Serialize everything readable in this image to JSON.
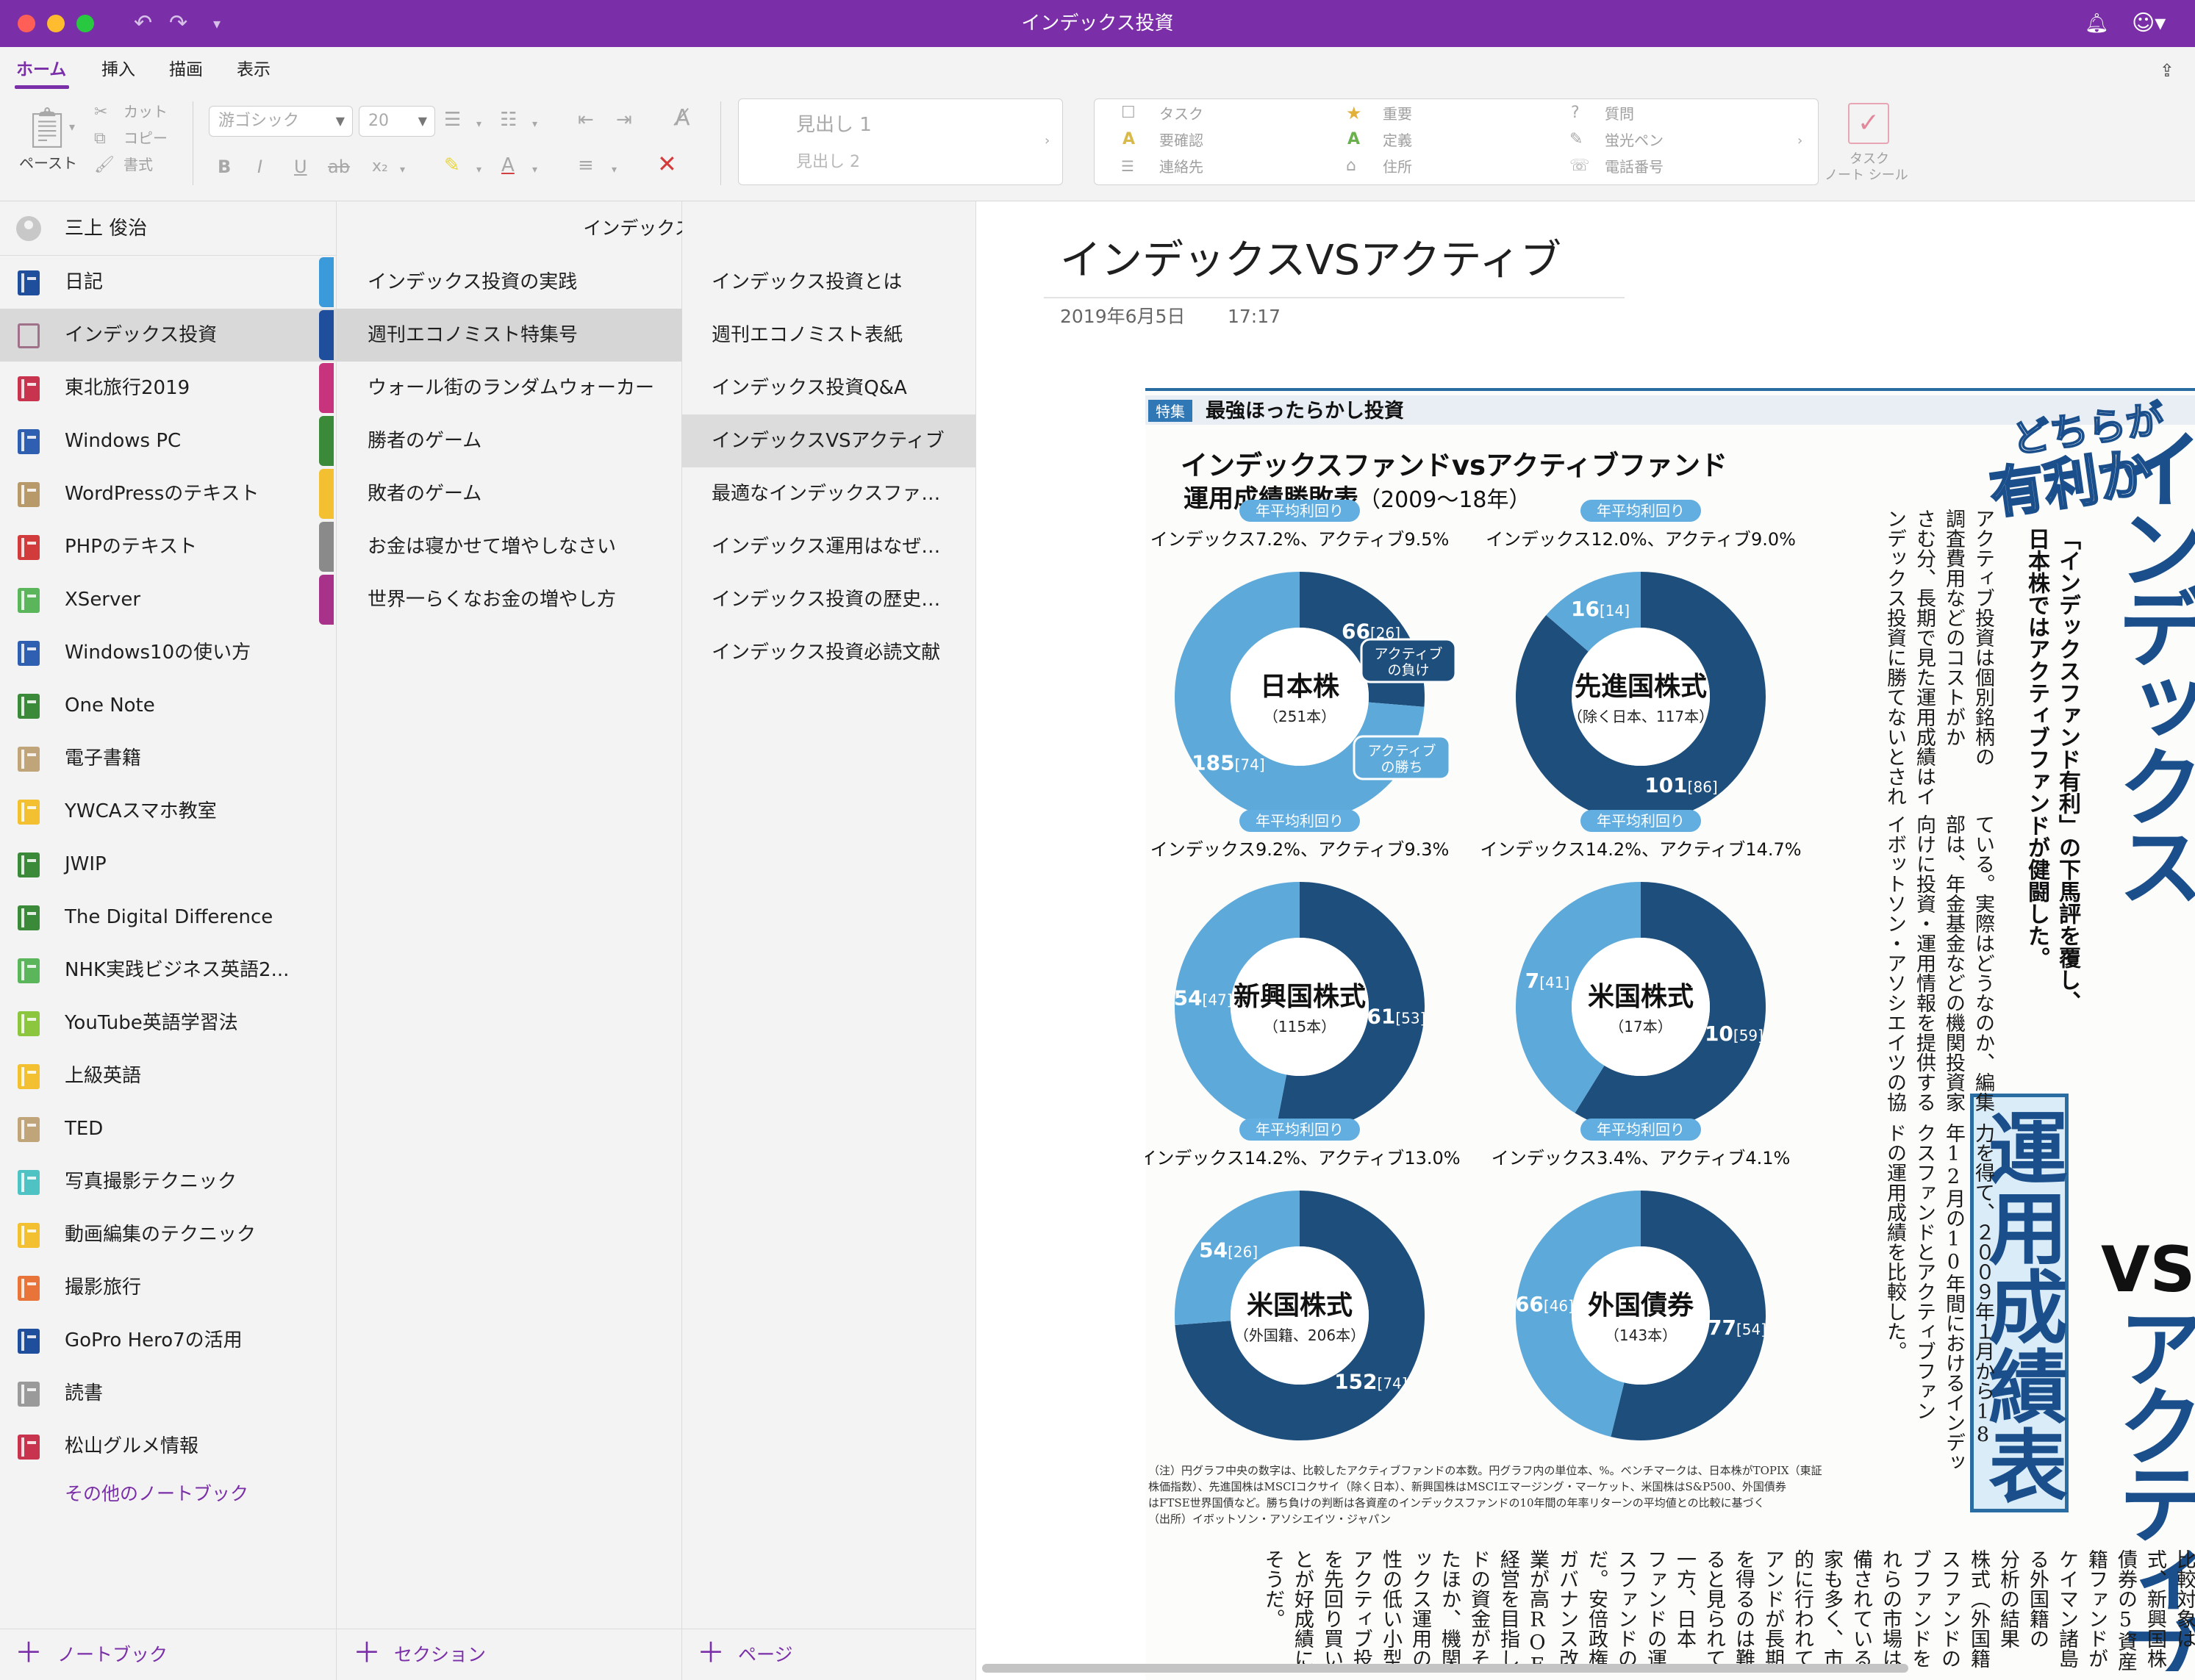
{
  "window": {
    "title": "インデックス投資"
  },
  "ribbon": {
    "tabs": [
      "ホーム",
      "挿入",
      "描画",
      "表示"
    ],
    "clipboard": {
      "paste": "ペースト",
      "cut": "カット",
      "copy": "コピー",
      "format": "書式"
    },
    "font": {
      "family": "游ゴシック",
      "size": "20"
    },
    "styles": {
      "heading1": "見出し 1",
      "heading2": "見出し 2"
    },
    "tags": {
      "col1": [
        "タスク",
        "要確認",
        "連絡先"
      ],
      "col2": [
        "重要",
        "定義",
        "住所"
      ],
      "col3": [
        "質問",
        "蛍光ペン",
        "電話番号"
      ]
    },
    "task_tag": {
      "line1": "タスク",
      "line2": "ノート シール"
    }
  },
  "user": {
    "name": "三上 俊治"
  },
  "notebooks": [
    {
      "label": "日記",
      "color": "#1f4e9c"
    },
    {
      "label": "インデックス投資",
      "color": "#a0728a"
    },
    {
      "label": "東北旅行2019",
      "color": "#c8334e"
    },
    {
      "label": "Windows PC",
      "color": "#2e5fb0"
    },
    {
      "label": "WordPressのテキスト",
      "color": "#b89a6a"
    },
    {
      "label": "PHPのテキスト",
      "color": "#d23b3b"
    },
    {
      "label": "XServer",
      "color": "#5bb55b"
    },
    {
      "label": "Windows10の使い方",
      "color": "#2e5fb0"
    },
    {
      "label": "One Note",
      "color": "#3a8a3a"
    },
    {
      "label": "電子書籍",
      "color": "#c0a57a"
    },
    {
      "label": "YWCAスマホ教室",
      "color": "#f2c030"
    },
    {
      "label": "JWIP",
      "color": "#3a8a3a"
    },
    {
      "label": "The Digital Difference",
      "color": "#3a8a3a"
    },
    {
      "label": "NHK実践ビジネス英語2...",
      "color": "#5bb55b"
    },
    {
      "label": "YouTube英語学習法",
      "color": "#8cc63e"
    },
    {
      "label": "上級英語",
      "color": "#f2c030"
    },
    {
      "label": "TED",
      "color": "#c0a57a"
    },
    {
      "label": "写真撮影テクニック",
      "color": "#4fc3c3"
    },
    {
      "label": "動画編集のテクニック",
      "color": "#f2c030"
    },
    {
      "label": "撮影旅行",
      "color": "#e8743a"
    },
    {
      "label": "GoPro Hero7の活用",
      "color": "#1f4e9c"
    },
    {
      "label": "読書",
      "color": "#9a9a9a"
    },
    {
      "label": "松山グルメ情報",
      "color": "#c8334e"
    }
  ],
  "more_notebooks": "その他のノートブック",
  "add_notebook": "ノートブック",
  "sections_header": "インデックス投資",
  "sections": [
    {
      "label": "インデックス投資の実践",
      "color": "#3b9ad9"
    },
    {
      "label": "週刊エコノミスト特集号",
      "color": "#1f4e9c"
    },
    {
      "label": "ウォール街のランダムウォーカー",
      "color": "#c8337e"
    },
    {
      "label": "勝者のゲーム",
      "color": "#3a8a3a"
    },
    {
      "label": "敗者のゲーム",
      "color": "#f2c030"
    },
    {
      "label": "お金は寝かせて増やしなさい",
      "color": "#8a8a8a"
    },
    {
      "label": "世界一らくなお金の増やし方",
      "color": "#a8328a"
    }
  ],
  "add_section": "セクション",
  "pages": [
    "インデックス投資とは",
    "週刊エコノミスト表紙",
    "インデックス投資Q&A",
    "インデックスVSアクティブ",
    "最適なインデックスファ…",
    "インデックス運用はなぜ…",
    "インデックス投資の歴史…",
    "インデックス投資必読文献"
  ],
  "add_page": "ページ",
  "note": {
    "title": "インデックスVSアクティブ",
    "date": "2019年6月5日",
    "time": "17:17"
  },
  "magazine": {
    "tag": "特集",
    "header": "最強ほったらかし投資",
    "chart_title": "インデックスファンドvsアクティブファンド",
    "chart_subtitle_main": "運用成績勝敗表",
    "chart_subtitle_period": "（2009〜18年）",
    "badge": "年平均利回り",
    "callout_lose": [
      "アクティブ",
      "の負け"
    ],
    "callout_win": [
      "アクティブ",
      "の勝ち"
    ],
    "headline_top": "どちらが",
    "headline_sub": "有利か",
    "headline_main_1": "インデックス",
    "headline_vs": "VS",
    "headline_main_2": "アクティブ",
    "headline_box": "運用成績表",
    "lead_1": "「インデックスファンド有利」の下馬評を覆し、",
    "lead_2": "日本株ではアクティブファンドが健闘した。",
    "body_cols": [
      "アクティブ投資は個別銘柄の",
      "調査費用などのコストがか",
      "さむ分、長期で見た運用成績はイ",
      "ンデックス投資に勝てないとされ",
      "ている。実際はどうなのか、編集",
      "部は、年金基金などの機関投資家",
      "向けに投資・運用情報を提供する",
      "イボットソン・アソシエイツの協",
      "力を得て、２００９年１月から18",
      "年12月の10年間におけるインデッ",
      "クスファンドとアクティブファン",
      "ドの運用成績を比較した。"
    ],
    "bottom_cols": [
      "比較対象は",
      "式、新興国株",
      "債券の5資産",
      "籍ファンドが",
      "ケイマン諸島",
      "る外国籍の",
      "分析の結果",
      "株式（外国籍",
      "スファンドの",
      "ブファンドを",
      "れらの市場は",
      "備されている",
      "家も多く、市",
      "的に行われて",
      "アンドが長期",
      "を得るのは難",
      "ると見られて",
      "一方、日本",
      "ファンドの運",
      "スファンドの",
      "だ。安倍政権",
      "ガバナンス改",
      "業が高ROE",
      "経営を目指し",
      "ドの資金がそ",
      "たほか、機関",
      "ックス運用の",
      "性の低い小型",
      "アクティブ投",
      "を先回り買い",
      "とが好成績に",
      "そうだ。"
    ],
    "footnote": [
      "（注）円グラフ中央の数字は、比較したアクティブファンドの本数。円グラフ内の単位本、%。ベンチマークは、日本株がTOPIX（東証",
      "株価指数）、先進国株はMSCIコクサイ（除く日本）、新興国株はMSCIエマージング・マーケット、米国株はS&P500、外国債券",
      "はFTSE世界国債など。勝ち負けの判断は各資産のインデックスファンドの10年間の年率リターンの平均値との比較に基づく",
      "（出所）イボットソン・アソシエイツ・ジャパン"
    ]
  },
  "chart_data": {
    "type": "pie",
    "charts": [
      {
        "name": "日本株",
        "count_label": "（251本）",
        "yields": "インデックス7.2%、アクティブ9.5%",
        "lose": 66,
        "lose_label": "[26]",
        "win": 185,
        "win_label": "[74]"
      },
      {
        "name": "先進国株式",
        "count_label": "（除く日本、117本）",
        "yields": "インデックス12.0%、アクティブ9.0%",
        "lose": 101,
        "lose_label": "[86]",
        "win": 16,
        "win_label": "[14]"
      },
      {
        "name": "新興国株式",
        "count_label": "（115本）",
        "yields": "インデックス9.2%、アクティブ9.3%",
        "lose": 61,
        "lose_label": "[53]",
        "win": 54,
        "win_label": "[47]"
      },
      {
        "name": "米国株式",
        "count_label": "（17本）",
        "yields": "インデックス14.2%、アクティブ14.7%",
        "lose": 10,
        "lose_label": "[59]",
        "win": 7,
        "win_label": "[41]"
      },
      {
        "name": "米国株式",
        "count_label": "（外国籍、206本）",
        "yields": "インデックス14.2%、アクティブ13.0%",
        "lose": 152,
        "lose_label": "[74]",
        "win": 54,
        "win_label": "[26]"
      },
      {
        "name": "外国債券",
        "count_label": "（143本）",
        "yields": "インデックス3.4%、アクティブ4.1%",
        "lose": 77,
        "lose_label": "[54]",
        "win": 66,
        "win_label": "[46]"
      }
    ],
    "colors": {
      "lose": "#1e4f7c",
      "win": "#5ca9da"
    }
  }
}
